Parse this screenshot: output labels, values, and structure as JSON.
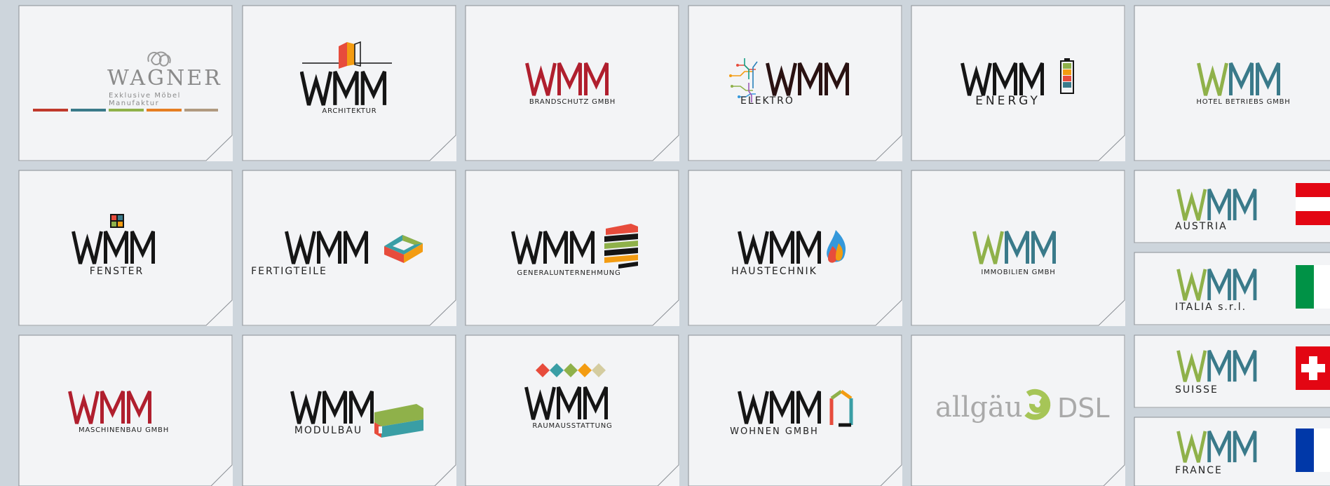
{
  "colors": {
    "background": "#cdd5dc",
    "tile": "#f3f4f6",
    "tile_border": "#8a8f95",
    "wmm_black": "#151515",
    "wmm_red": "#b01f2e",
    "wmm_green": "#8fb14a",
    "wmm_teal": "#3a7a8a",
    "austria_red": "#e30613",
    "italy_green": "#009246",
    "swiss_red": "#e30613",
    "france_blue": "#0038a8"
  },
  "tiles": {
    "wagner": {
      "name": "WAGNER",
      "tagline": "Exklusive Möbel Manufaktur"
    },
    "architektur": {
      "brand": "WMM",
      "caption": "ARCHITEKTUR"
    },
    "brandschutz": {
      "brand": "WMM",
      "caption": "BRANDSCHUTZ GMBH"
    },
    "elektro": {
      "brand": "WMM",
      "caption": "ELEKTRO"
    },
    "energy": {
      "brand": "WMM",
      "caption": "ENERGY"
    },
    "hotel": {
      "brand": "WMM",
      "caption": "HOTEL BETRIEBS GMBH"
    },
    "fenster": {
      "brand": "WMM",
      "caption": "FENSTER"
    },
    "fertigteile": {
      "brand": "WMM",
      "caption": "FERTIGTEILE"
    },
    "general": {
      "brand": "WMM",
      "caption": "GENERALUNTERNEHMUNG"
    },
    "haustechnik": {
      "brand": "WMM",
      "caption": "HAUSTECHNIK"
    },
    "immobilien": {
      "brand": "WMM",
      "caption": "IMMOBILIEN GMBH"
    },
    "austria": {
      "brand": "WMM",
      "caption": "AUSTRIA"
    },
    "italia": {
      "brand": "WMM",
      "caption": "ITALIA s.r.l."
    },
    "suisse": {
      "brand": "WMM",
      "caption": "SUISSE"
    },
    "france": {
      "brand": "WMM",
      "caption": "FRANCE"
    },
    "maschinenbau": {
      "brand": "WMM",
      "caption": "MASCHINENBAU GMBH"
    },
    "modulbau": {
      "brand": "WMM",
      "caption": "MODULBAU"
    },
    "raum": {
      "brand": "WMM",
      "caption": "RAUMAUSSTATTUNG"
    },
    "wohnen": {
      "brand": "WMM",
      "caption": "WOHNEN GMBH"
    },
    "dsl": {
      "brand_left": "allgäu",
      "brand_right": "DSL"
    }
  }
}
